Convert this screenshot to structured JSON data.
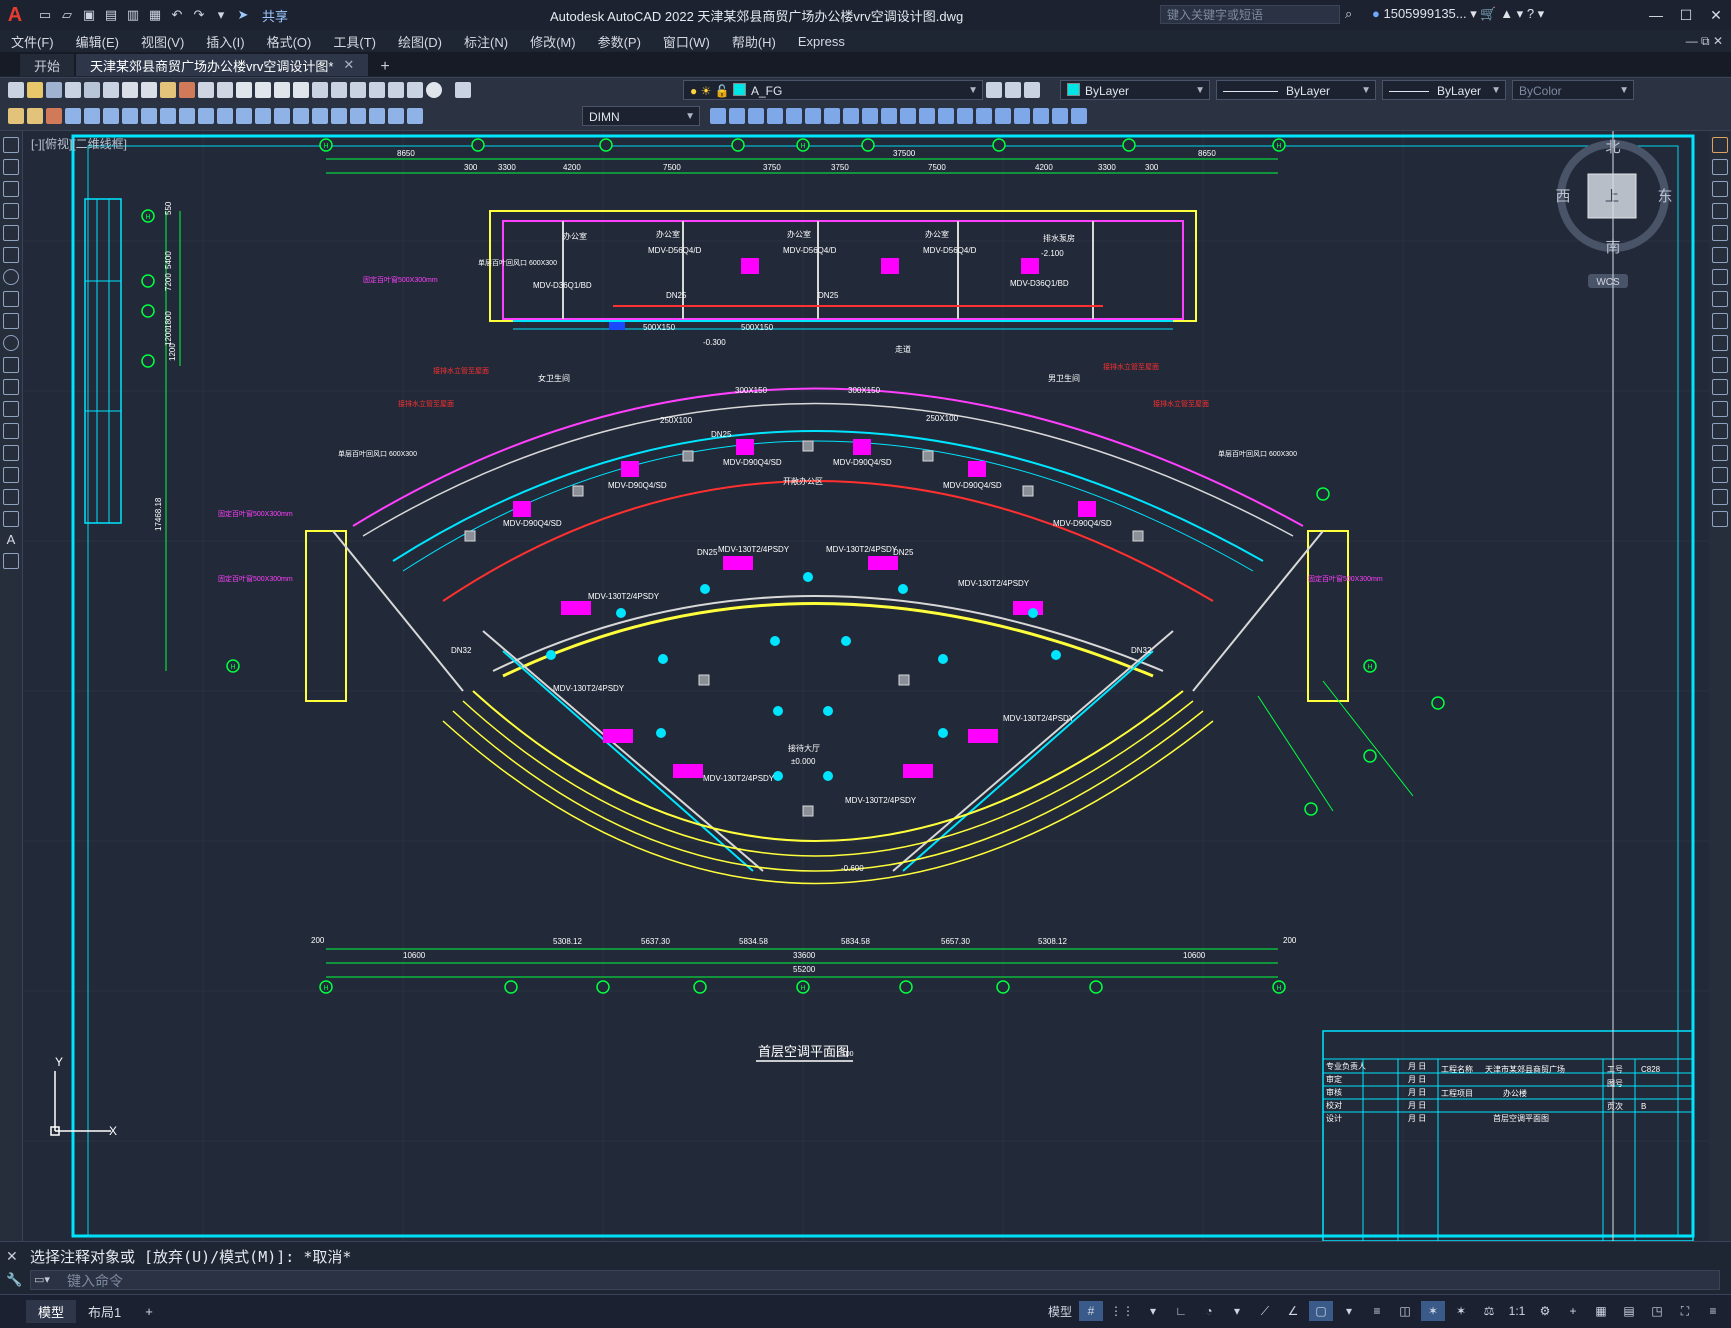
{
  "app": {
    "logo_letter": "A",
    "title": "Autodesk AutoCAD 2022    天津某郊县商贸广场办公楼vrv空调设计图.dwg",
    "share_label": "共享",
    "search_placeholder": "键入关键字或短语",
    "user_name": "1505999135...",
    "accent_color": "#e63b2e"
  },
  "menu": [
    "文件(F)",
    "编辑(E)",
    "视图(V)",
    "插入(I)",
    "格式(O)",
    "工具(T)",
    "绘图(D)",
    "标注(N)",
    "修改(M)",
    "参数(P)",
    "窗口(W)",
    "帮助(H)",
    "Express"
  ],
  "tabs": [
    {
      "label": "开始"
    },
    {
      "label": "天津某郊县商贸广场办公楼vrv空调设计图*"
    }
  ],
  "toolbar": {
    "layer": "A_FG",
    "layer_color": "#00e5e5",
    "color": "ByLayer",
    "linetype": "ByLayer",
    "lineweight": "ByLayer",
    "plotstyle": "ByColor",
    "dimstyle": "DIMN"
  },
  "viewport": {
    "label": "[-][俯视][二维线框]"
  },
  "viewcube": {
    "north": "北",
    "south": "南",
    "east": "东",
    "west": "西",
    "face": "上",
    "wcs": "WCS"
  },
  "drawing": {
    "title": "首层空调平面图",
    "scale": "1:100",
    "dims_top": [
      "8650",
      "300",
      "3300",
      "4200",
      "7500",
      "3750",
      "3750",
      "7500",
      "4200",
      "3300",
      "300",
      "8650"
    ],
    "dim_top_total": "37500",
    "dims_bottom": [
      "5308.12",
      "5637.30",
      "5834.58",
      "5834.58",
      "5657.30",
      "5308.12"
    ],
    "dims_bottom_outer": [
      "10600",
      "33600",
      "10600"
    ],
    "dim_bottom_total": "55200",
    "dim_bottom_edge": "200",
    "dims_left": [
      "550",
      "5400",
      "7200",
      "1800",
      "1200",
      "1200"
    ],
    "dim_left_total": "17468.18",
    "rooms": [
      "办公室",
      "办公室",
      "办公室",
      "办公室",
      "排水泵房",
      "走道",
      "开敞办公区",
      "接待大厅",
      "女卫生间",
      "男卫生间"
    ],
    "units_top": [
      "MDV-D36Q1/BD",
      "MDV-D56Q4/D",
      "MDV-D56Q4/D",
      "MDV-D56Q4/D",
      "MDV-D36Q1/BD"
    ],
    "units_mid": [
      "MDV-D90Q4/SD",
      "MDV-D90Q4/SD",
      "MDV-D90Q4/SD",
      "MDV-D90Q4/SD",
      "MDV-D90Q4/SD",
      "MDV-D90Q4/SD"
    ],
    "units_lobby": [
      "MDV-130T2/4PSDY",
      "MDV-130T2/4PSDY",
      "MDV-130T2/4PSDY",
      "MDV-130T2/4PSDY",
      "MDV-130T2/4PSDY",
      "MDV-130T2/4PSDY",
      "MDV-130T2/4PSDY",
      "MDV-130T2/4PSDY"
    ],
    "pipe_labels": [
      "DN25",
      "DN25",
      "DN25",
      "DN32",
      "DN32",
      "DN25",
      "DN25"
    ],
    "duct_labels": [
      "500X150",
      "300X150",
      "250X100",
      "500X150",
      "300X150",
      "250X100"
    ],
    "levels": [
      "-0.300",
      "±0.000",
      "-0.600",
      "-2.100"
    ],
    "vent_labels": [
      "固定百叶窗500X300mm",
      "固定百叶窗500X300mm",
      "固定百叶窗500X300mm",
      "固定百叶窗500X300mm"
    ],
    "exhaust_labels": [
      "单层百叶回风口 600X300",
      "单层百叶回风口 600X300",
      "单层百叶回风口 600X300"
    ],
    "riser_labels": [
      "接排水立管至屋面",
      "接排水立管至屋面",
      "接排水立管至屋面",
      "接排水立管至屋面"
    ],
    "grid_bubble": "H",
    "titleblock": {
      "project": "天津市某郊县商贸广场",
      "sub": "办公楼",
      "drawing": "首层空调平面图",
      "rows": [
        "专业负责人",
        "审定",
        "审核",
        "校对",
        "设计"
      ],
      "date_label": "月 日",
      "proj_label": "工程名称",
      "item_label": "工程项目",
      "right_labels": [
        "工号",
        "图号",
        "页次"
      ],
      "right_values": [
        "C828",
        "",
        "B"
      ]
    }
  },
  "command": {
    "history": "选择注释对象或 [放弃(U)/模式(M)]: *取消*",
    "placeholder": "键入命令"
  },
  "layouts": [
    {
      "label": "模型"
    },
    {
      "label": "布局1"
    }
  ],
  "status": {
    "model_label": "模型",
    "scale": "1:1"
  }
}
